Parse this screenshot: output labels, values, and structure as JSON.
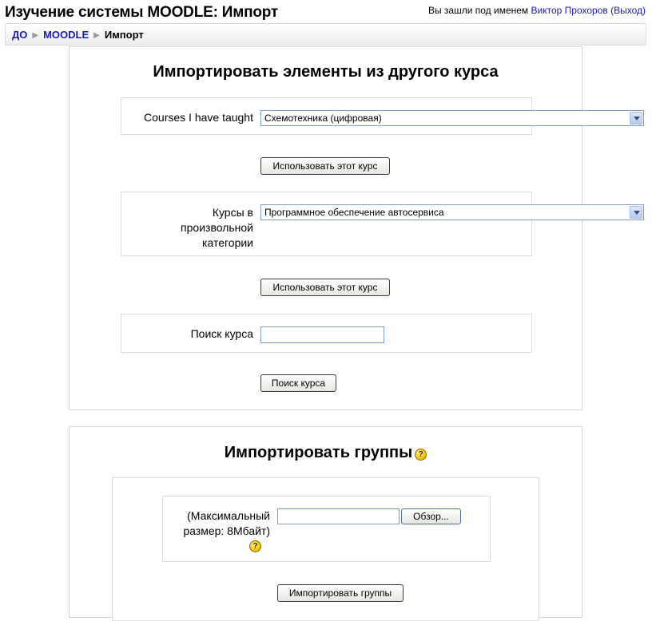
{
  "header": {
    "title": "Изучение системы MOODLE: Импорт",
    "login_prefix": "Вы зашли под именем ",
    "user_name": "Виктор Прохоров",
    "logout": "(Выход)"
  },
  "breadcrumb": {
    "items": [
      "ДО",
      "MOODLE",
      "Импорт"
    ]
  },
  "import_elements": {
    "heading": "Импортировать элементы из другого курса",
    "taught_label": "Courses I have taught",
    "taught_selected": "Схемотехника (цифровая)",
    "use_course_button": "Использовать этот курс",
    "category_label": "Курсы в произвольной категории",
    "category_selected": "Программное обеспечение автосервиса",
    "use_course_button_2": "Использовать этот курс",
    "search_label": "Поиск курса",
    "search_value": "",
    "search_button": "Поиск курса"
  },
  "import_groups": {
    "heading": "Импортировать группы",
    "file_label": "(Максимальный размер: 8Мбайт)",
    "file_value": "",
    "browse_button": "Обзор...",
    "submit_button": "Импортировать группы"
  },
  "icons": {
    "help": "help-icon",
    "help_glyph": "?"
  }
}
